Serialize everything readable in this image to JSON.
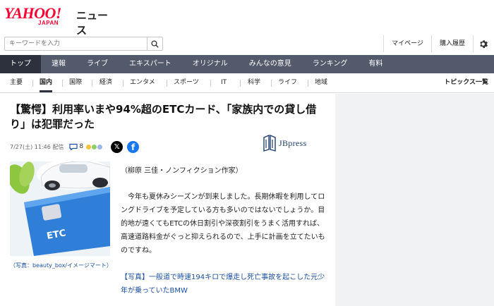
{
  "header": {
    "logo_yahoo": "YAHOO!",
    "logo_japan": "JAPAN",
    "logo_news": "ニュース",
    "search_placeholder": "キーワードを入力",
    "links": [
      "マイページ",
      "購入履歴"
    ]
  },
  "main_nav": {
    "items": [
      "トップ",
      "速報",
      "ライブ",
      "エキスパート",
      "オリジナル",
      "みんなの意見",
      "ランキング",
      "有料"
    ],
    "active_index": 0
  },
  "sub_nav": {
    "items": [
      "主要",
      "国内",
      "国際",
      "経済",
      "エンタメ",
      "スポーツ",
      "IT",
      "科学",
      "ライフ",
      "地域"
    ],
    "active_index": 1,
    "topics_label": "トピックス一覧"
  },
  "article": {
    "title": "【驚愕】利用率いまや94%超のETCカード、「家族内での貸し借り」は犯罪だった",
    "date": "7/27(土) 11:46 配信",
    "comment_count": "8",
    "publisher": "JBpress",
    "image_caption": "（写真：beauty_box/イメージマート）",
    "card_text": "ETC",
    "byline": "（柳原 三佳・ノンフィクション作家）",
    "paragraph": "今年も夏休みシーズンが到来しました。長期休暇を利用してロングドライブを予定している方も多いのではないでしょうか。目的地が遠くてもETCの休日割引や深夜割引をうまく活用すれば、高速道路料金がぐっと抑えられるので、上手に計画を立てたいものですね。",
    "related_link": "【写真】一般道で時速194キロで爆走し死亡事故を起こした元少年が乗っていたBMW"
  },
  "colors": {
    "brand_red": "#ff0033",
    "nav_bg": "#535a6b",
    "nav_active": "#2c313d",
    "link_blue": "#1a4fa0"
  }
}
